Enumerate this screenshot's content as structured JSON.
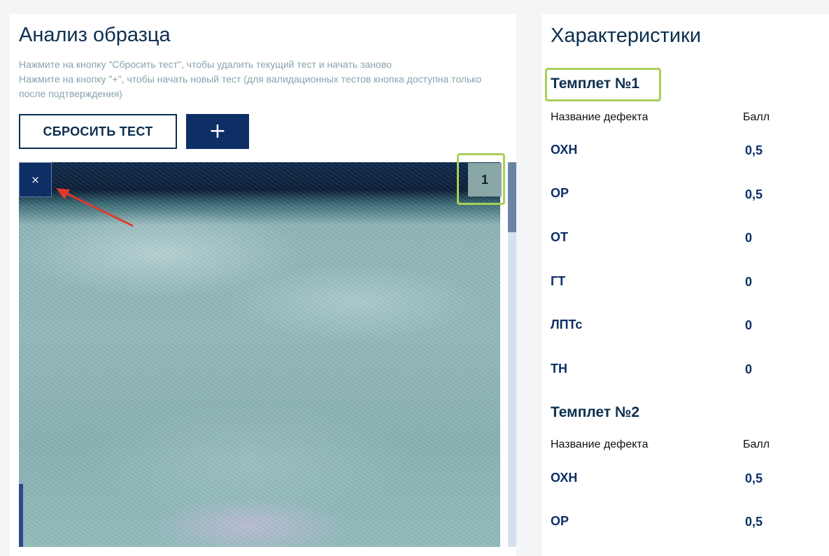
{
  "analysis": {
    "title": "Анализ образца",
    "hint_line1": "Нажмите на кнопку \"Сбросить тест\", чтобы удалить текущий тест и начать заново",
    "hint_line2": "Нажмите на кнопку \"+\", чтобы начать новый тест (для валидационных тестов кнопка доступна только после подтверждения)",
    "reset_label": "СБРОСИТЬ ТЕСТ",
    "add_label": "+",
    "close_label": "×",
    "image_index": "1"
  },
  "characteristics": {
    "title": "Характеристики",
    "templates": [
      {
        "title": "Темплет №1",
        "col_name": "Название дефекта",
        "col_score": "Балл",
        "rows": [
          {
            "name": "ОХН",
            "score": "0,5"
          },
          {
            "name": "ОР",
            "score": "0,5"
          },
          {
            "name": "ОТ",
            "score": "0"
          },
          {
            "name": "ГТ",
            "score": "0"
          },
          {
            "name": "ЛПТс",
            "score": "0"
          },
          {
            "name": "ТН",
            "score": "0"
          }
        ]
      },
      {
        "title": "Темплет №2",
        "col_name": "Название дефекта",
        "col_score": "Балл",
        "rows": [
          {
            "name": "ОХН",
            "score": "0,5"
          },
          {
            "name": "ОР",
            "score": "0,5"
          }
        ]
      }
    ]
  },
  "colors": {
    "primary": "#0d2f66",
    "title": "#0d2f4f",
    "hint": "#8aa2ad",
    "highlight": "#a9cf5a",
    "annotation_arrow": "#e0392b"
  }
}
